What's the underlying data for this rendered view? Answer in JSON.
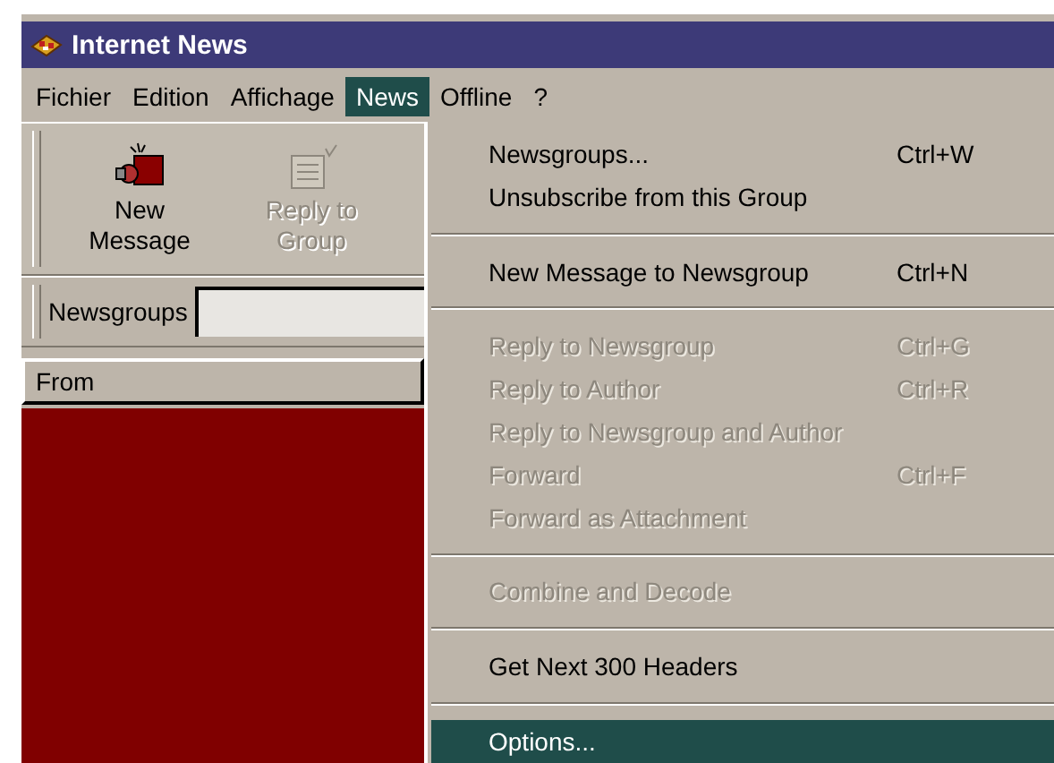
{
  "window": {
    "title": "Internet News"
  },
  "menu_bar": [
    {
      "label": "Fichier",
      "selected": false
    },
    {
      "label": "Edition",
      "selected": false
    },
    {
      "label": "Affichage",
      "selected": false
    },
    {
      "label": "News",
      "selected": true
    },
    {
      "label": "Offline",
      "selected": false
    },
    {
      "label": "?",
      "selected": false
    }
  ],
  "toolbar": [
    {
      "label": "New Message",
      "kind": "new",
      "disabled": false
    },
    {
      "label": "Reply to Group",
      "kind": "reply",
      "disabled": true
    }
  ],
  "newsgroups_bar": {
    "label": "Newsgroups"
  },
  "message_list": {
    "columns": [
      "From"
    ]
  },
  "dropdown_menu": [
    {
      "kind": "item",
      "label": "Newsgroups...",
      "shortcut": "Ctrl+W",
      "disabled": false,
      "selected": false
    },
    {
      "kind": "item",
      "label": "Unsubscribe from this Group",
      "disabled": false,
      "selected": false
    },
    {
      "kind": "separator"
    },
    {
      "kind": "item",
      "label": "New Message to Newsgroup",
      "shortcut": "Ctrl+N",
      "disabled": false,
      "selected": false
    },
    {
      "kind": "separator"
    },
    {
      "kind": "item",
      "label": "Reply to Newsgroup",
      "shortcut": "Ctrl+G",
      "disabled": true,
      "selected": false
    },
    {
      "kind": "item",
      "label": "Reply to Author",
      "shortcut": "Ctrl+R",
      "disabled": true,
      "selected": false
    },
    {
      "kind": "item",
      "label": "Reply to Newsgroup and Author",
      "disabled": true,
      "selected": false
    },
    {
      "kind": "item",
      "label": "Forward",
      "shortcut": "Ctrl+F",
      "disabled": true,
      "selected": false
    },
    {
      "kind": "item",
      "label": "Forward as Attachment",
      "disabled": true,
      "selected": false
    },
    {
      "kind": "separator"
    },
    {
      "kind": "item",
      "label": "Combine and Decode",
      "disabled": true,
      "selected": false
    },
    {
      "kind": "separator"
    },
    {
      "kind": "item",
      "label": "Get Next 300 Headers",
      "disabled": false,
      "selected": false
    },
    {
      "kind": "separator"
    },
    {
      "kind": "item",
      "label": "Options...",
      "disabled": false,
      "selected": true
    }
  ]
}
